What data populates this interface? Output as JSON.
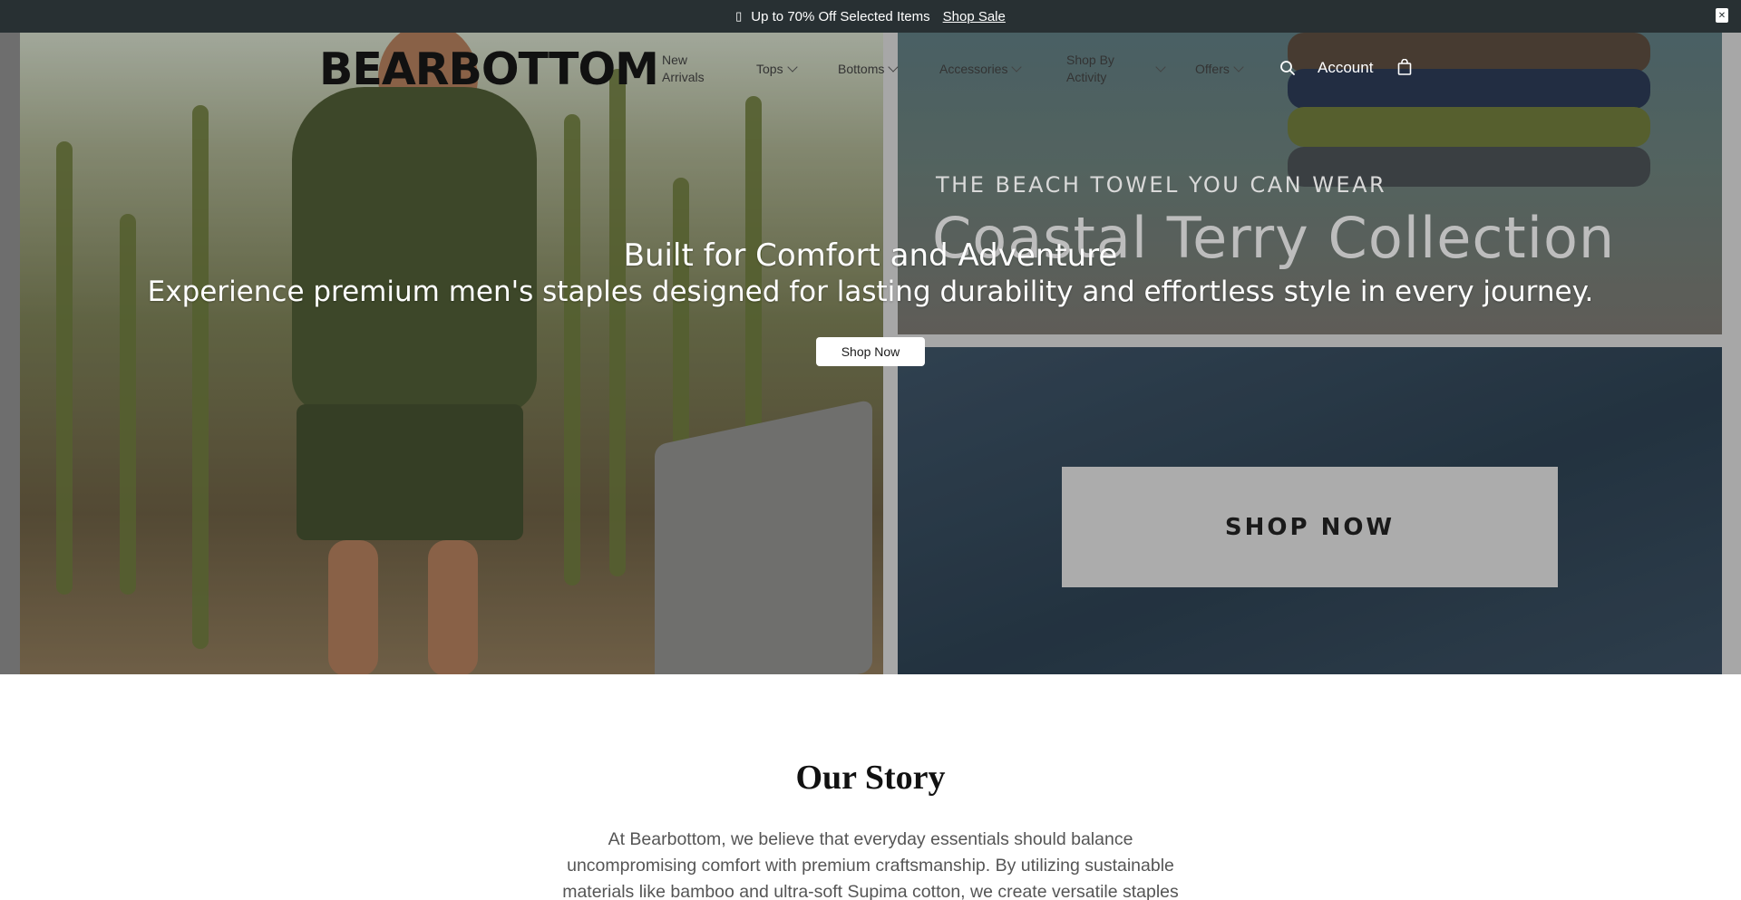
{
  "announcement": {
    "icon": "tag-icon",
    "text": "Up to 70% Off Selected Items",
    "link": "Shop Sale",
    "close_icon": "close-icon"
  },
  "header": {
    "logo": "BEARBOTTOM",
    "nav": [
      {
        "label": "New Arrivals",
        "dropdown": false
      },
      {
        "label": "Tops",
        "dropdown": true
      },
      {
        "label": "Bottoms",
        "dropdown": true
      },
      {
        "label": "Accessories",
        "dropdown": true
      },
      {
        "label": "Shop By Activity",
        "dropdown": true
      },
      {
        "label": "Offers",
        "dropdown": true
      }
    ],
    "account": "Account",
    "icons": {
      "search": "search-icon",
      "bag": "bag-icon"
    }
  },
  "promo": {
    "eyebrow": "THE BEACH TOWEL YOU CAN WEAR",
    "title": "Coastal Terry Collection",
    "button": "SHOP NOW"
  },
  "hero": {
    "heading": "Built for Comfort and Adventure",
    "subheading": "Experience premium men's staples designed for lasting durability and effortless style in every journey.",
    "button": "Shop Now"
  },
  "story": {
    "title": "Our Story",
    "body": "At Bearbottom, we believe that everyday essentials should balance uncompromising comfort with premium craftsmanship. By utilizing sustainable materials like bamboo and ultra-soft Supima cotton, we create versatile staples"
  },
  "colors": {
    "announcement_bg": "#283033",
    "promo_button_bg": "#acacac"
  }
}
